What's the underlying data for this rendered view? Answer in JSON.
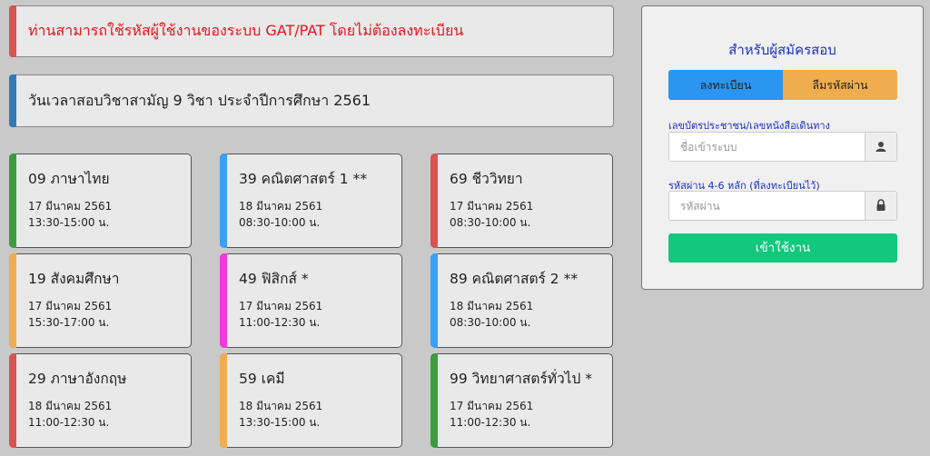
{
  "notice": "ท่านสามารถใช้รหัสผู้ใช้งานของระบบ GAT/PAT โดยไม่ต้องลงทะเบียน",
  "schedule_title": "วันเวลาสอบวิชาสามัญ 9 วิชา ประจำปีการศึกษา 2561",
  "exams": [
    {
      "subject": "09 ภาษาไทย",
      "date": "17 มีนาคม 2561",
      "time": "13:30-15:00 น.",
      "color": "#3c9c3f"
    },
    {
      "subject": "39 คณิตศาสตร์ 1 **",
      "date": "18 มีนาคม 2561",
      "time": "08:30-10:00 น.",
      "color": "#3aa0f5"
    },
    {
      "subject": "69 ชีววิทยา",
      "date": "17 มีนาคม 2561",
      "time": "08:30-10:00 น.",
      "color": "#d9534f"
    },
    {
      "subject": "19 สังคมศึกษา",
      "date": "17 มีนาคม 2561",
      "time": "15:30-17:00 น.",
      "color": "#f0ad4e"
    },
    {
      "subject": "49 ฟิสิกส์ *",
      "date": "17 มีนาคม 2561",
      "time": "11:00-12:30 น.",
      "color": "#f03adc"
    },
    {
      "subject": "89 คณิตศาสตร์ 2 **",
      "date": "18 มีนาคม 2561",
      "time": "08:30-10:00 น.",
      "color": "#3aa0f5"
    },
    {
      "subject": "29 ภาษาอังกฤษ",
      "date": "18 มีนาคม 2561",
      "time": "11:00-12:30 น.",
      "color": "#d9534f"
    },
    {
      "subject": "59 เคมี",
      "date": "18 มีนาคม 2561",
      "time": "13:30-15:00 น.",
      "color": "#f0ad4e"
    },
    {
      "subject": "99 วิทยาศาสตร์ทั่วไป *",
      "date": "17 มีนาคม 2561",
      "time": "11:00-12:30 น.",
      "color": "#3c9c3f"
    }
  ],
  "login": {
    "title": "สำหรับผู้สมัครสอบ",
    "register_label": "ลงทะเบียน",
    "forgot_label": "ลืมรหัสผ่าน",
    "id_label": "เลขบัตรประชาชน/เลขหนังสือเดินทาง",
    "id_placeholder": "ชื่อเข้าระบบ",
    "id_icon": "user-icon",
    "password_label": "รหัสผ่าน 4-6 หลัก (ที่ลงทะเบียนไว้)",
    "password_placeholder": "รหัสผ่าน",
    "password_icon": "lock-icon",
    "submit_label": "เข้าใช้งาน"
  }
}
